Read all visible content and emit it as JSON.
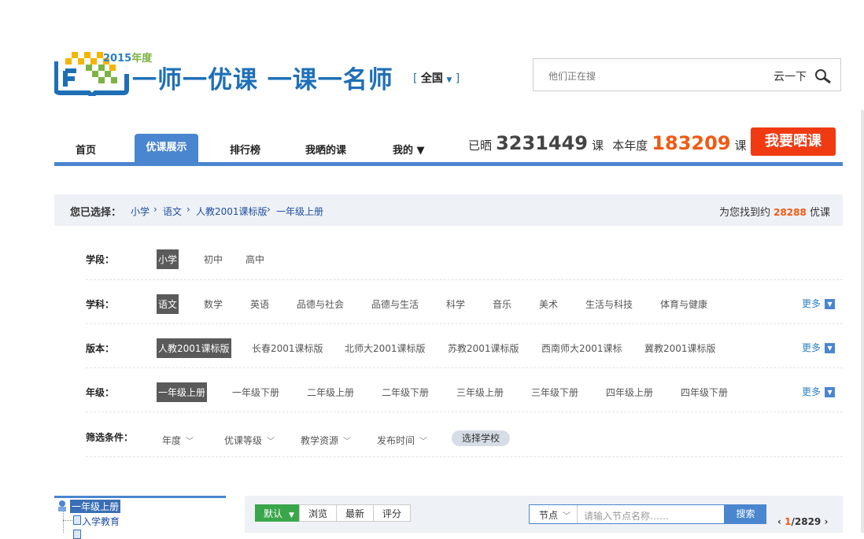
{
  "logo": {
    "year_num": "2015",
    "year_suffix": "年度",
    "slogan": "一师一优课  一课一名师"
  },
  "region": {
    "name": "全国"
  },
  "search": {
    "placeholder": "他们正在搜",
    "button": "云一下"
  },
  "nav": {
    "items": [
      "首页",
      "优课展示",
      "排行榜",
      "我晒的课",
      "我的 ▼"
    ],
    "active": "优课展示"
  },
  "stats": {
    "label1": "已晒",
    "count1": "3231449",
    "unit": "课",
    "label2": "本年度",
    "count2": "183209"
  },
  "share_button": "我要晒课",
  "breadcrumb": {
    "label": "您已选择：",
    "items": [
      "小学",
      "语文",
      "人教2001课标版",
      "一年级上册"
    ],
    "found_prefix": "为您找到约",
    "found_count": "28288",
    "found_suffix": "优课"
  },
  "filters": {
    "stage": {
      "label": "学段：",
      "options": [
        "小学",
        "初中",
        "高中"
      ]
    },
    "subject": {
      "label": "学科：",
      "options": [
        "语文",
        "数学",
        "英语",
        "品德与社会",
        "品德与生活",
        "科学",
        "音乐",
        "美术",
        "生活与科技",
        "体育与健康"
      ]
    },
    "edition": {
      "label": "版本：",
      "options": [
        "人教2001课标版",
        "长春2001课标版",
        "北师大2001课标版",
        "苏教2001课标版",
        "西南师大2001课标",
        "冀教2001课标版"
      ]
    },
    "grade": {
      "label": "年级：",
      "options": [
        "一年级上册",
        "一年级下册",
        "二年级上册",
        "二年级下册",
        "三年级上册",
        "三年级下册",
        "四年级上册",
        "四年级下册"
      ]
    },
    "more": "更多",
    "conditions": {
      "label": "筛选条件：",
      "items": [
        "年度",
        "优课等级",
        "教学资源",
        "发布时间"
      ],
      "school_button": "选择学校"
    }
  },
  "tree": {
    "selected": "一年级上册",
    "child": "入学教育"
  },
  "toolbar": {
    "sorts": [
      "默认",
      "浏览",
      "最新",
      "评分"
    ],
    "node_label": "节点",
    "node_placeholder": "请输入节点名称……",
    "search_button": "搜索",
    "page_current": "1",
    "page_total": "/2829"
  },
  "colors": {
    "brand_blue": "#4a86cf",
    "accent_orange": "#f05a14",
    "cta_red": "#f03a12",
    "sort_green": "#3aa64a"
  }
}
